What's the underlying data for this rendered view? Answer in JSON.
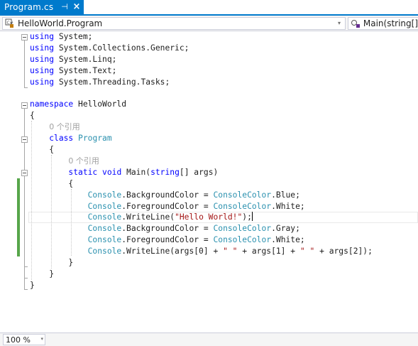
{
  "tab": {
    "title": "Program.cs",
    "pin_glyph": "⊣",
    "close_glyph": "×",
    "pin_icon": "pin-icon",
    "close_icon": "close-icon"
  },
  "nav": {
    "class_text": "HelloWorld.Program",
    "member_text": "Main(string[]",
    "class_icon": "csharp-class-icon",
    "member_icon": "method-icon",
    "dropdown_glyph": "▾"
  },
  "code": {
    "lines": [
      [
        {
          "t": "using",
          "c": "kw"
        },
        {
          "t": " System;",
          "c": ""
        }
      ],
      [
        {
          "t": "using",
          "c": "kw"
        },
        {
          "t": " System.Collections.Generic;",
          "c": ""
        }
      ],
      [
        {
          "t": "using",
          "c": "kw"
        },
        {
          "t": " System.Linq;",
          "c": ""
        }
      ],
      [
        {
          "t": "using",
          "c": "kw"
        },
        {
          "t": " System.Text;",
          "c": ""
        }
      ],
      [
        {
          "t": "using",
          "c": "kw"
        },
        {
          "t": " System.Threading.Tasks;",
          "c": ""
        }
      ],
      [],
      [
        {
          "t": "namespace",
          "c": "kw"
        },
        {
          "t": " HelloWorld",
          "c": ""
        }
      ],
      [
        {
          "t": "{",
          "c": ""
        }
      ],
      [
        {
          "t": "    ",
          "c": ""
        },
        {
          "t": "0 个引用",
          "c": "ref"
        }
      ],
      [
        {
          "t": "    ",
          "c": ""
        },
        {
          "t": "class",
          "c": "kw"
        },
        {
          "t": " ",
          "c": ""
        },
        {
          "t": "Program",
          "c": "ty"
        }
      ],
      [
        {
          "t": "    {",
          "c": ""
        }
      ],
      [
        {
          "t": "        ",
          "c": ""
        },
        {
          "t": "0 个引用",
          "c": "ref"
        }
      ],
      [
        {
          "t": "        ",
          "c": ""
        },
        {
          "t": "static",
          "c": "kw"
        },
        {
          "t": " ",
          "c": ""
        },
        {
          "t": "void",
          "c": "kw"
        },
        {
          "t": " Main(",
          "c": ""
        },
        {
          "t": "string",
          "c": "kw"
        },
        {
          "t": "[] args)",
          "c": ""
        }
      ],
      [
        {
          "t": "        {",
          "c": ""
        }
      ],
      [
        {
          "t": "            ",
          "c": ""
        },
        {
          "t": "Console",
          "c": "ty"
        },
        {
          "t": ".BackgroundColor = ",
          "c": ""
        },
        {
          "t": "ConsoleColor",
          "c": "ty"
        },
        {
          "t": ".Blue;",
          "c": ""
        }
      ],
      [
        {
          "t": "            ",
          "c": ""
        },
        {
          "t": "Console",
          "c": "ty"
        },
        {
          "t": ".ForegroundColor = ",
          "c": ""
        },
        {
          "t": "ConsoleColor",
          "c": "ty"
        },
        {
          "t": ".White;",
          "c": ""
        }
      ],
      [
        {
          "t": "            ",
          "c": ""
        },
        {
          "t": "Console",
          "c": "ty"
        },
        {
          "t": ".WriteLine(",
          "c": ""
        },
        {
          "t": "\"Hello World!\"",
          "c": "str"
        },
        {
          "t": ");",
          "c": ""
        },
        {
          "t": "|caret",
          "c": "caret"
        }
      ],
      [
        {
          "t": "            ",
          "c": ""
        },
        {
          "t": "Console",
          "c": "ty"
        },
        {
          "t": ".BackgroundColor = ",
          "c": ""
        },
        {
          "t": "ConsoleColor",
          "c": "ty"
        },
        {
          "t": ".Gray;",
          "c": ""
        }
      ],
      [
        {
          "t": "            ",
          "c": ""
        },
        {
          "t": "Console",
          "c": "ty"
        },
        {
          "t": ".ForegroundColor = ",
          "c": ""
        },
        {
          "t": "ConsoleColor",
          "c": "ty"
        },
        {
          "t": ".White;",
          "c": ""
        }
      ],
      [
        {
          "t": "            ",
          "c": ""
        },
        {
          "t": "Console",
          "c": "ty"
        },
        {
          "t": ".WriteLine(args[0] + ",
          "c": ""
        },
        {
          "t": "\" \"",
          "c": "str"
        },
        {
          "t": " + args[1] + ",
          "c": ""
        },
        {
          "t": "\" \"",
          "c": "str"
        },
        {
          "t": " + args[2]);",
          "c": ""
        }
      ],
      [
        {
          "t": "        }",
          "c": ""
        }
      ],
      [
        {
          "t": "    }",
          "c": ""
        }
      ],
      [
        {
          "t": "}",
          "c": ""
        }
      ]
    ]
  },
  "status": {
    "zoom": "100 %"
  },
  "colors": {
    "accent": "#007acc",
    "keyword": "#0000ff",
    "type": "#2b91af",
    "string": "#a31515",
    "change_bar": "#57a64a"
  }
}
